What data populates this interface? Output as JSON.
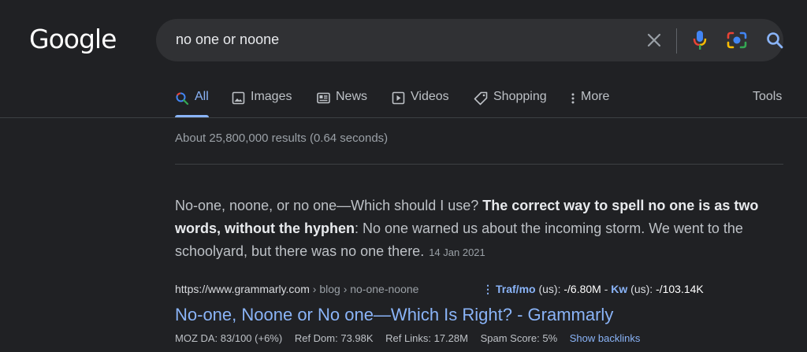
{
  "logo": "Google",
  "search": {
    "query": "no one or noone"
  },
  "icons": [
    "clear-icon",
    "mic-icon",
    "lens-icon",
    "search-icon"
  ],
  "colors": {
    "background": "#202124",
    "link": "#8ab4f8",
    "surface": "#303134"
  },
  "tabs": [
    {
      "label": "All",
      "icon": "search-icon",
      "active": true
    },
    {
      "label": "Images",
      "icon": "image-icon"
    },
    {
      "label": "News",
      "icon": "news-icon"
    },
    {
      "label": "Videos",
      "icon": "video-icon"
    },
    {
      "label": "Shopping",
      "icon": "tag-icon"
    },
    {
      "label": "More",
      "icon": "more-vert-icon"
    }
  ],
  "tools_label": "Tools",
  "result_stats": "About 25,800,000 results (0.64 seconds)",
  "snippet": {
    "lead": "No-one, noone, or no one—Which should I use? ",
    "bold": "The correct way to spell no one is as two words, without the hyphen",
    "rest": ": No one warned us about the incoming storm. We went to the schoolyard, but there was no one there.",
    "date": "14 Jan 2021"
  },
  "result": {
    "domain": "https://www.grammarly.com",
    "path": " › blog › no-one-noone",
    "seo": {
      "traf_label": "Traf/mo",
      "traf_region": " (us): ",
      "traf_value": "-/6.80M",
      "sep": " - ",
      "kw_label": "Kw",
      "kw_region": " (us): ",
      "kw_value": "-/103.14K"
    },
    "title": "No-one, Noone or No one—Which Is Right? - Grammarly",
    "metrics": {
      "moz_da": "MOZ DA: 83/100 (+6%)",
      "ref_dom": "Ref Dom: 73.98K",
      "ref_links": "Ref Links: 17.28M",
      "spam_score": "Spam Score: 5%",
      "backlinks": "Show backlinks"
    }
  }
}
